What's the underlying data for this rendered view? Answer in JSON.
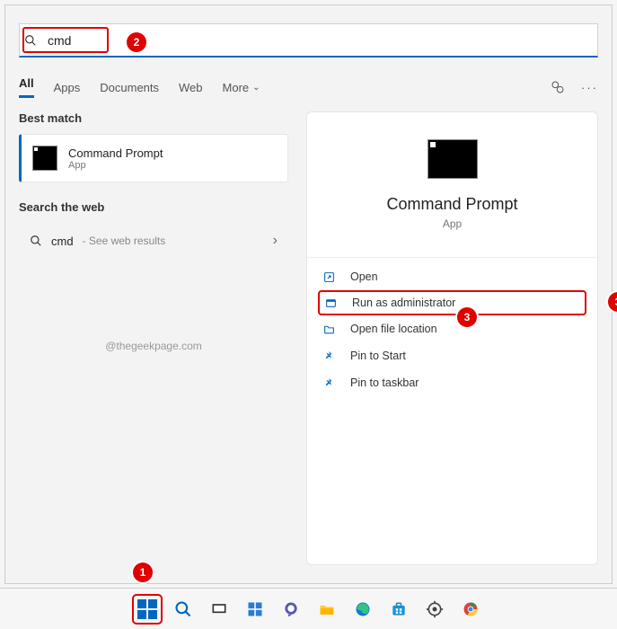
{
  "search": {
    "query": "cmd"
  },
  "tabs": {
    "all": "All",
    "apps": "Apps",
    "documents": "Documents",
    "web": "Web",
    "more": "More"
  },
  "sections": {
    "best_match": "Best match",
    "search_web": "Search the web"
  },
  "best_match": {
    "title": "Command Prompt",
    "subtitle": "App"
  },
  "web_result": {
    "term": "cmd",
    "suffix": " - See web results"
  },
  "watermark": "@thegeekpage.com",
  "preview": {
    "title": "Command Prompt",
    "subtitle": "App"
  },
  "actions": {
    "open": "Open",
    "run_admin": "Run as administrator",
    "open_loc": "Open file location",
    "pin_start": "Pin to Start",
    "pin_taskbar": "Pin to taskbar"
  },
  "annotations": {
    "1": "1",
    "2": "2",
    "3": "3"
  }
}
